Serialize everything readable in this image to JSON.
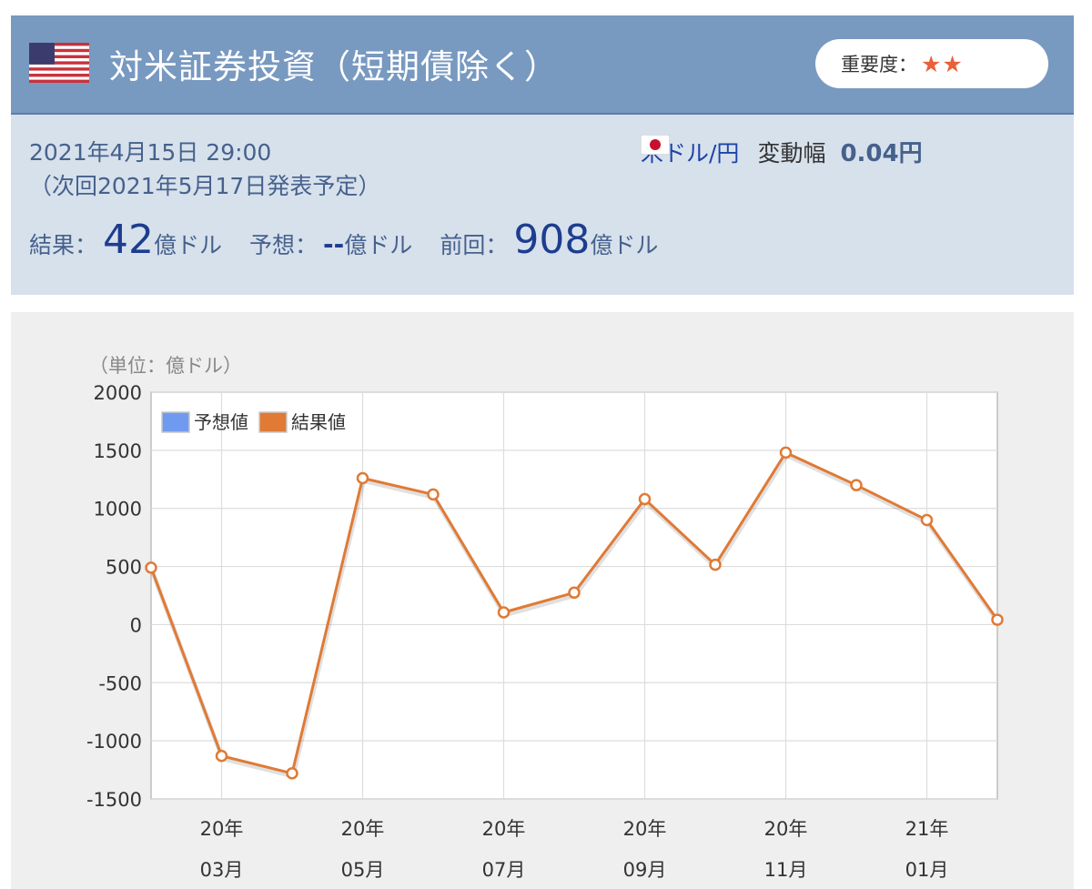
{
  "header": {
    "title": "対米証券投資（短期債除く）",
    "importance_label": "重要度：",
    "importance_stars": "★★",
    "flag_icon": "us-flag-icon"
  },
  "info": {
    "date": "2021年4月15日 29:00",
    "next_release": "（次回2021年5月17日発表予定）",
    "pair": "米ドル/円",
    "volatility_label": "変動幅",
    "volatility_value": "0.04円",
    "result_label": "結果：",
    "result_value": "42",
    "forecast_label": "予想：",
    "forecast_value": "--",
    "previous_label": "前回：",
    "previous_value": "908",
    "unit": "億ドル"
  },
  "colors": {
    "header_bg": "#7899c0",
    "info_bg": "#d7e1ec",
    "result_series": "#e07a35",
    "forecast_series": "#6f9af0"
  },
  "chart_data": {
    "type": "line",
    "unit_label": "（単位：億ドル）",
    "ylim": [
      -1500,
      2000
    ],
    "yticks": [
      2000,
      1500,
      1000,
      500,
      0,
      -500,
      -1000,
      -1500
    ],
    "x_tick_labels": [
      {
        "year": "20年",
        "month": "03月",
        "index": 1
      },
      {
        "year": "20年",
        "month": "05月",
        "index": 3
      },
      {
        "year": "20年",
        "month": "07月",
        "index": 5
      },
      {
        "year": "20年",
        "month": "09月",
        "index": 7
      },
      {
        "year": "20年",
        "month": "11月",
        "index": 9
      },
      {
        "year": "21年",
        "month": "01月",
        "index": 11
      }
    ],
    "legend": [
      "予想値",
      "結果値"
    ],
    "legend_placement": "top-left",
    "grid": true,
    "series": [
      {
        "name": "結果値",
        "x": [
          "2020-02",
          "2020-03",
          "2020-04",
          "2020-05",
          "2020-06",
          "2020-07",
          "2020-08",
          "2020-09",
          "2020-10",
          "2020-11",
          "2020-12",
          "2021-01",
          "2021-02"
        ],
        "values": [
          490,
          -1130,
          -1280,
          1260,
          1120,
          105,
          275,
          1080,
          515,
          1480,
          1200,
          900,
          42
        ]
      },
      {
        "name": "予想値",
        "values": []
      }
    ]
  }
}
